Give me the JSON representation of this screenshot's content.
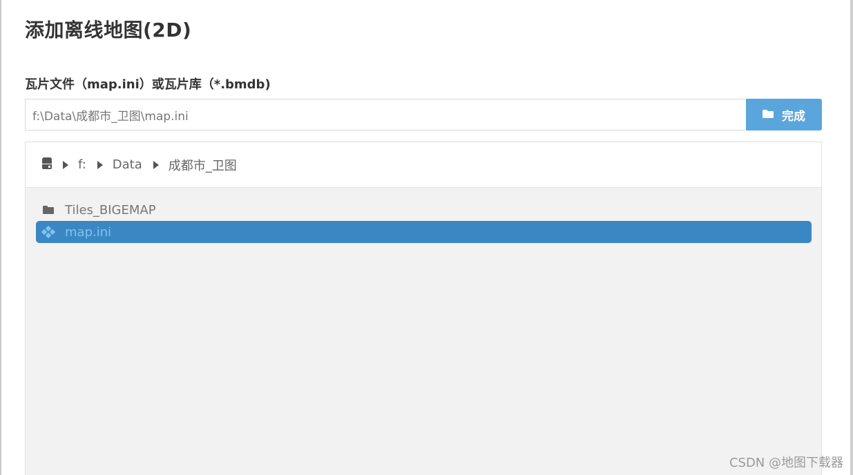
{
  "dialog": {
    "title": "添加离线地图(2D)"
  },
  "path_field": {
    "label": "瓦片文件（map.ini）或瓦片库（*.bmdb)",
    "value": "f:\\Data\\成都市_卫图\\map.ini",
    "done_button_label": "完成",
    "done_button_icon": "folder-icon"
  },
  "breadcrumb": {
    "root_icon": "drive-icon",
    "items": [
      "f:",
      "Data",
      "成都市_卫图"
    ]
  },
  "file_list": {
    "items": [
      {
        "name": "Tiles_BIGEMAP",
        "icon": "folder-icon",
        "selected": false
      },
      {
        "name": "map.ini",
        "icon": "tiles-icon",
        "selected": true
      }
    ]
  },
  "colors": {
    "accent": "#5aa6dc",
    "selected_row": "#3b87c3",
    "selected_text": "#7fc3f0",
    "list_background": "#f2f2f2"
  },
  "watermark": "CSDN @地图下载器"
}
